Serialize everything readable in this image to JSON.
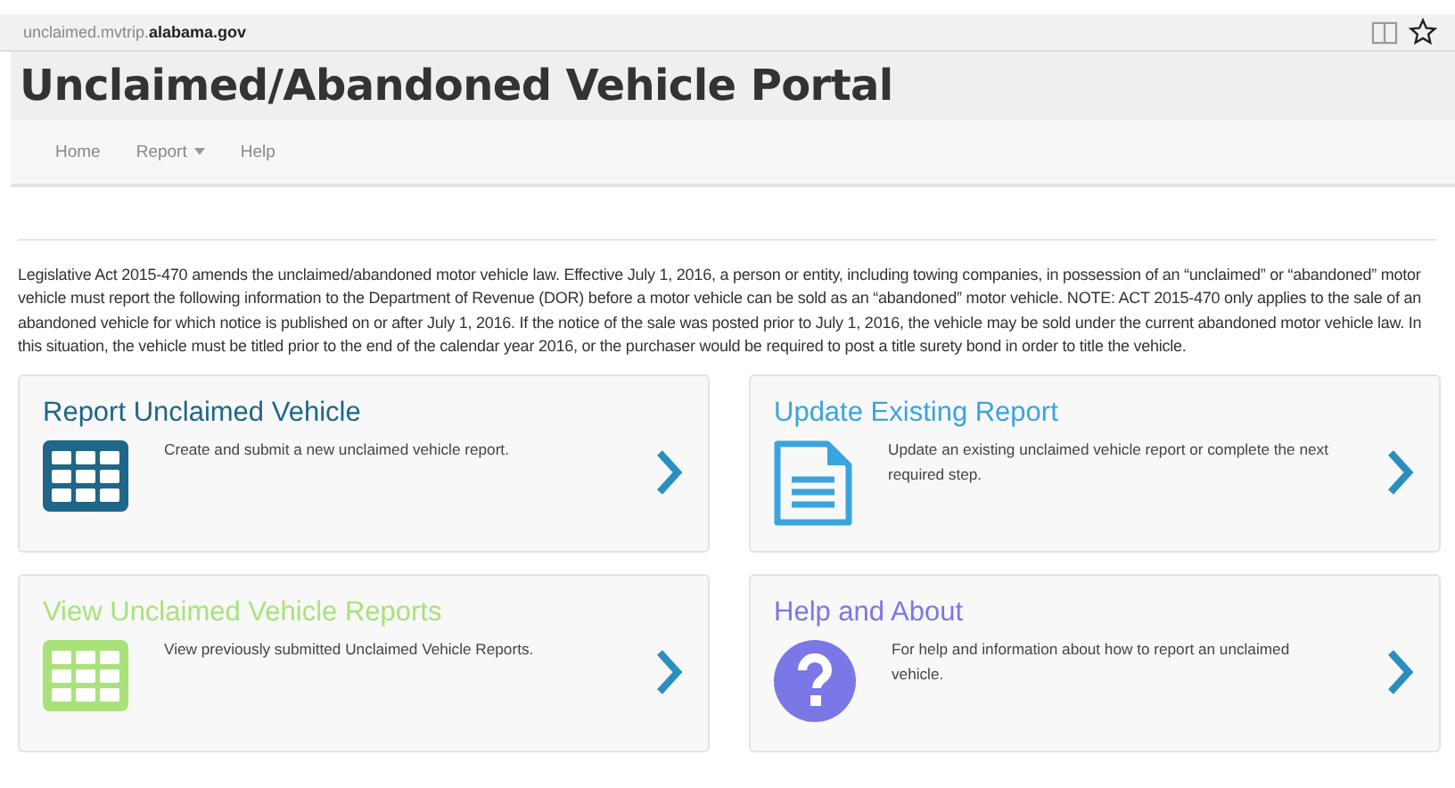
{
  "browser": {
    "url_host": "unclaimed.mvtrip.",
    "url_domain": "alabama.gov"
  },
  "site_title": "Unclaimed/Abandoned Vehicle Portal",
  "nav": [
    {
      "label": "Home",
      "dropdown": false
    },
    {
      "label": "Report",
      "dropdown": true
    },
    {
      "label": "Help",
      "dropdown": false
    }
  ],
  "intro": "Legislative Act 2015-470 amends the unclaimed/abandoned motor vehicle law. Effective July 1, 2016, a person or entity, including towing companies, in possession of an “unclaimed” or “abandoned” motor vehicle must report the following information to the Department of Revenue (DOR) before a motor vehicle can be sold as an “abandoned” motor vehicle. NOTE: ACT 2015-470 only applies to the sale of an abandoned vehicle for which notice is published on or after July 1, 2016. If the notice of the sale was posted prior to July 1, 2016, the vehicle may be sold under the current abandoned motor vehicle law. In this situation, the vehicle must be titled prior to the end of the calendar year 2016, or the purchaser would be required to post a title surety bond in order to title the vehicle.",
  "cards": [
    {
      "title": "Report Unclaimed Vehicle",
      "description": "Create and submit a new unclaimed vehicle report.",
      "kind": "grid",
      "color": "#1f6688"
    },
    {
      "title": "Update Existing Report",
      "description": "Update an existing unclaimed vehicle report or complete the next required step.",
      "kind": "document",
      "color": "#3aa4dd"
    },
    {
      "title": "View Unclaimed Vehicle Reports",
      "description": "View previously submitted Unclaimed Vehicle Reports.",
      "kind": "grid",
      "color": "#a9e27a"
    },
    {
      "title": "Help and About",
      "description": "For help and information about how to report an unclaimed vehicle.",
      "kind": "question",
      "color": "#7b77e6"
    }
  ]
}
